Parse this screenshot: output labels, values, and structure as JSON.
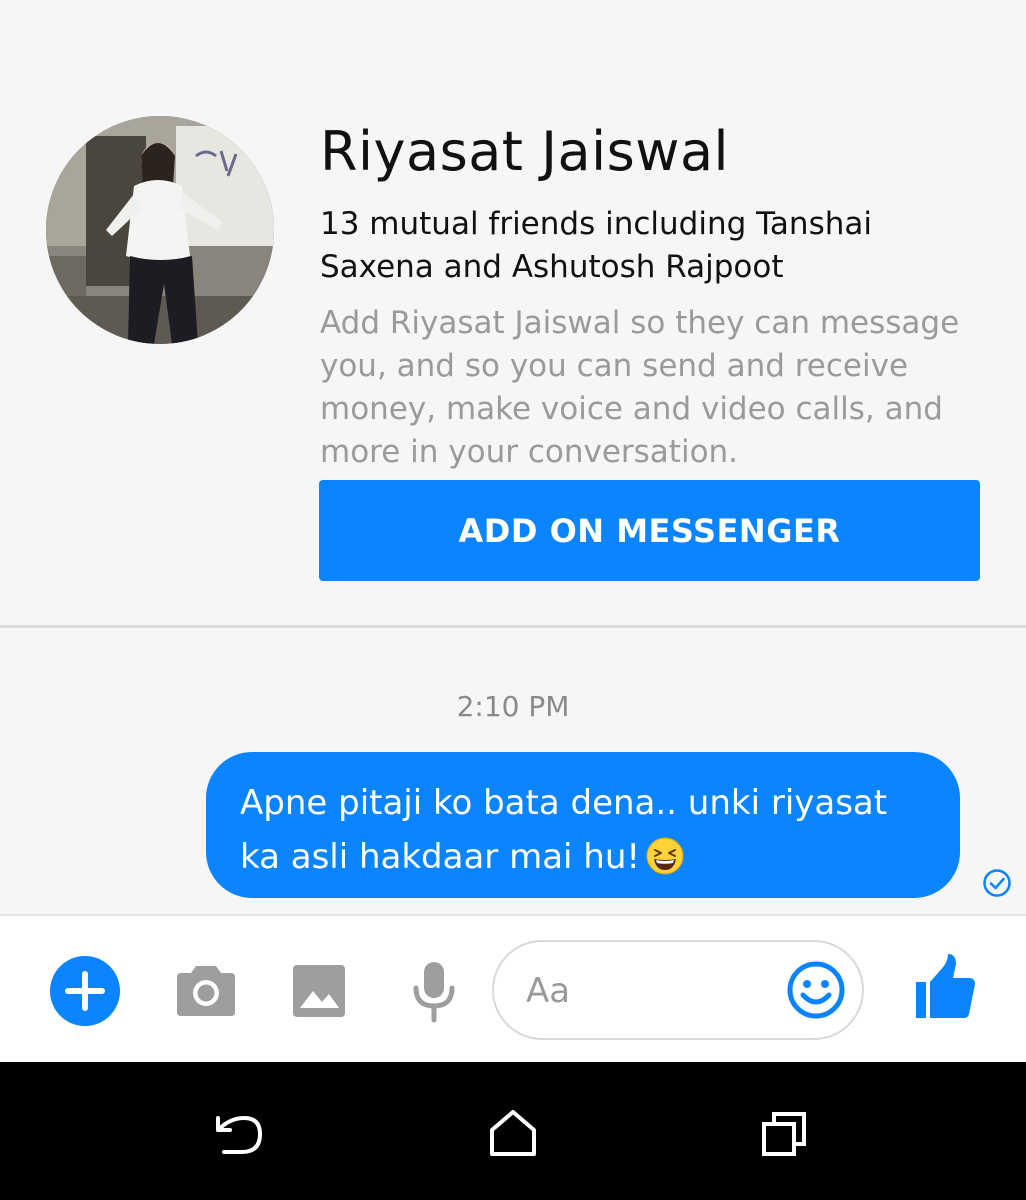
{
  "profile": {
    "name": "Riyasat Jaiswal",
    "mutual_friends": "13 mutual friends including Tanshai Saxena and Ashutosh Rajpoot",
    "description": "Add Riyasat Jaiswal so they can message you, and so you can send and receive money, make voice and video calls, and more in your conversation.",
    "add_button": "ADD ON MESSENGER"
  },
  "conversation": {
    "timestamp": "2:10 PM",
    "messages": [
      {
        "text": "Apne pitaji ko bata dena.. unki riyasat ka asli hakdaar mai hu!",
        "emoji": "grinning-squinting-face",
        "status_icon": "delivered-check-icon"
      }
    ]
  },
  "composer": {
    "placeholder": "Aa",
    "icons": [
      "plus-icon",
      "camera-icon",
      "image-icon",
      "microphone-icon",
      "smiley-icon",
      "thumbs-up-icon"
    ]
  },
  "navbar": {
    "icons": [
      "back-icon",
      "home-icon",
      "recents-icon"
    ]
  },
  "colors": {
    "accent": "#0a84ff",
    "background": "#f6f6f6",
    "secondary_text": "#9a9a9a",
    "icon_gray": "#9e9e9e"
  }
}
